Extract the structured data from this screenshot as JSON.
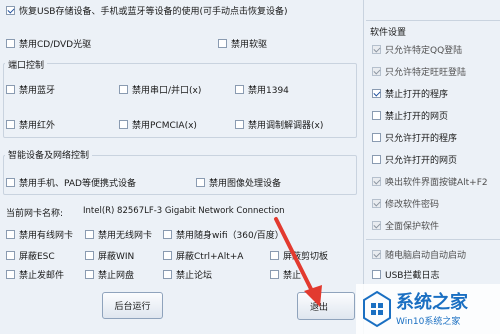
{
  "top": {
    "restore_usb_label": "恢复USB存储设备、手机或蓝牙等设备的使用(可手动点击恢复设备)",
    "disable_cd_label": "禁用CD/DVD光驱",
    "disable_floppy_label": "禁用软驱"
  },
  "port_group": {
    "title": "端口控制",
    "items": [
      "禁用蓝牙",
      "禁用串口/并口(x)",
      "禁用1394",
      "禁用红外",
      "禁用PCMCIA(x)",
      "禁用调制解调器(x)"
    ]
  },
  "smart_group": {
    "title": "智能设备及网络控制",
    "items": [
      "禁用手机、PAD等便携式设备",
      "禁用图像处理设备"
    ]
  },
  "nic": {
    "label": "当前网卡名称:",
    "value": "Intel(R) 82567LF-3 Gigabit Network Connection"
  },
  "net_grid": {
    "row1": [
      "禁用有线网卡",
      "禁用无线网卡",
      "禁用随身wifi（360/百度）"
    ],
    "row2": [
      "屏蔽ESC",
      "屏蔽WIN",
      "屏蔽Ctrl+Alt+A",
      "屏蔽剪切板"
    ],
    "row3": [
      "禁止发邮件",
      "禁止网盘",
      "禁止论坛",
      "禁止"
    ]
  },
  "buttons": {
    "background_run": "后台运行",
    "exit": "退出"
  },
  "settings": {
    "title": "软件设置",
    "items": [
      {
        "label": "只允许特定QQ登陆",
        "checked": true,
        "disabled": true
      },
      {
        "label": "只允许特定旺旺登陆",
        "checked": true,
        "disabled": true
      },
      {
        "label": "禁止打开的程序",
        "checked": true,
        "disabled": false
      },
      {
        "label": "禁止打开的网页",
        "checked": false,
        "disabled": false
      },
      {
        "label": "只允许打开的程序",
        "checked": false,
        "disabled": false
      },
      {
        "label": "只允许打开的网页",
        "checked": false,
        "disabled": false
      },
      {
        "label": "唤出软件界面按键Alt+F2",
        "checked": true,
        "disabled": true
      },
      {
        "label": "修改软件密码",
        "checked": true,
        "disabled": true
      },
      {
        "label": "全面保护软件",
        "checked": true,
        "disabled": true
      },
      {
        "label": "随电脑启动自动启动",
        "checked": true,
        "disabled": true
      },
      {
        "label": "USB拦截日志",
        "checked": false,
        "disabled": false
      }
    ]
  },
  "watermark": {
    "brand": "系统之家",
    "url": "Win10系统之家"
  },
  "colors": {
    "background": "#ecf1f7",
    "arrow": "#e23a2f",
    "watermark_blue": "#1a6fc2"
  }
}
